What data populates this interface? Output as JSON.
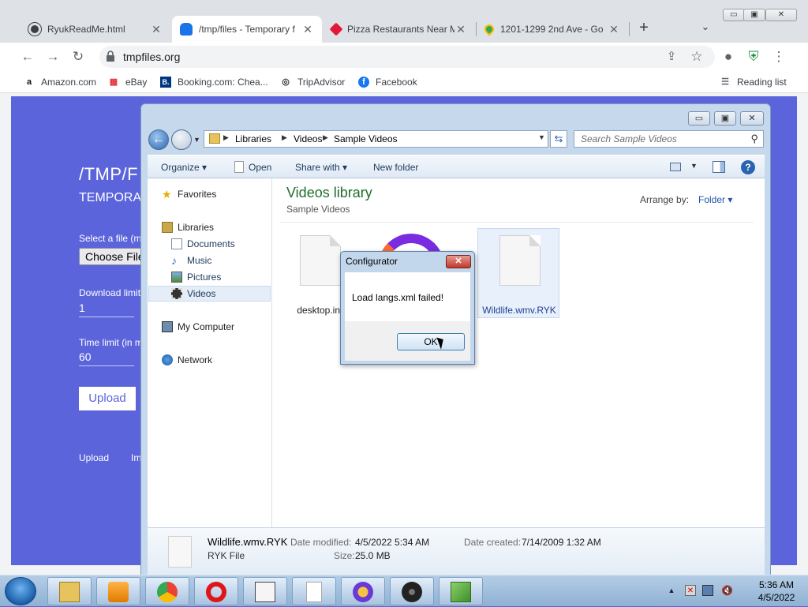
{
  "browser": {
    "tabs": [
      {
        "title": "RyukReadMe.html",
        "close": "✕",
        "active": false
      },
      {
        "title": "/tmp/files - Temporary f",
        "close": "✕",
        "active": true
      },
      {
        "title": "Pizza Restaurants Near M",
        "close": "✕",
        "active": false
      },
      {
        "title": "1201-1299 2nd Ave - Go",
        "close": "✕",
        "active": false
      }
    ],
    "new_tab": "+",
    "tab_search": "⌄",
    "window_controls": {
      "minimize": "▭",
      "maximize": "▣",
      "close": "✕"
    },
    "url": "tmpfiles.org",
    "bookmarks": [
      {
        "label": "Amazon.com",
        "icon": "amazon-icon",
        "glyph": "a"
      },
      {
        "label": "eBay",
        "icon": "ebay-icon",
        "glyph": "▦"
      },
      {
        "label": "Booking.com: Chea...",
        "icon": "booking-icon",
        "glyph": "B."
      },
      {
        "label": "TripAdvisor",
        "icon": "tripadvisor-icon",
        "glyph": "◎"
      },
      {
        "label": "Facebook",
        "icon": "facebook-icon",
        "glyph": "f"
      }
    ],
    "reading_list": "Reading list"
  },
  "page": {
    "title": "/TMP/F",
    "subtitle": "TEMPORA",
    "select_label": "Select a file (m",
    "choose_file": "Choose File",
    "download_limit_label": "Download limit",
    "download_limit_value": "1",
    "time_limit_label": "Time limit (in m",
    "time_limit_value": "60",
    "upload_button": "Upload",
    "footer_links": [
      "Upload",
      "Im"
    ]
  },
  "explorer": {
    "window_controls": {
      "minimize": "▭",
      "maximize": "▣",
      "close": "✕"
    },
    "breadcrumb": [
      "Libraries",
      "Videos",
      "Sample Videos"
    ],
    "search_placeholder": "Search Sample Videos",
    "commands": {
      "organize": "Organize ▾",
      "open": "Open",
      "share_with": "Share with ▾",
      "new_folder": "New folder"
    },
    "nav": {
      "favorites": "Favorites",
      "libraries": "Libraries",
      "documents": "Documents",
      "music": "Music",
      "pictures": "Pictures",
      "videos": "Videos",
      "my_computer": "My Computer",
      "network": "Network"
    },
    "library_title": "Videos library",
    "library_subtitle": "Sample Videos",
    "arrange_label": "Arrange by:",
    "arrange_value": "Folder ▾",
    "files": [
      {
        "name": "desktop.ini",
        "selected": false
      },
      {
        "name": "Wildlife.wmv.RYK",
        "selected": true
      }
    ],
    "details": {
      "filename": "Wildlife.wmv.RYK",
      "filetype": "RYK File",
      "modified_label": "Date modified:",
      "modified_value": "4/5/2022 5:34 AM",
      "created_label": "Date created:",
      "created_value": "7/14/2009 1:32 AM",
      "size_label": "Size:",
      "size_value": "25.0 MB"
    }
  },
  "dialog": {
    "title": "Configurator",
    "close": "✕",
    "message": "Load langs.xml failed!",
    "ok": "OK"
  },
  "taskbar": {
    "apps": [
      "explorer-icon",
      "media-player-icon",
      "chrome-icon",
      "opera-icon",
      "calculator-icon",
      "blank-document-icon",
      "vpn-shield-icon",
      "speaker-app-icon",
      "notepad-icon"
    ],
    "time": "5:36 AM",
    "date": "4/5/2022"
  },
  "colors": {
    "page_bg": "#5b64db",
    "library_title": "#1f6e2d",
    "link_blue": "#1f55a8"
  }
}
